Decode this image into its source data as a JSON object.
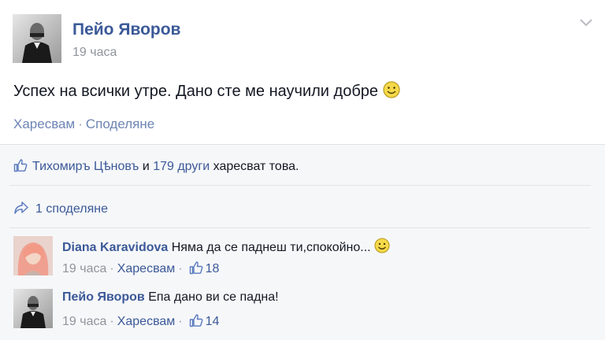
{
  "post": {
    "author": "Пейо Яворов",
    "timestamp": "19 часа",
    "text": "Успех на всички утре. Дано сте ме научили добре",
    "actions": {
      "like": "Харесвам",
      "share": "Споделяне",
      "separator": "·"
    }
  },
  "likes": {
    "first_name": "Тихомиръ Цѣновъ",
    "and": "и",
    "others": "179 други",
    "suffix": "харесват това."
  },
  "shares": {
    "label": "1 споделяне"
  },
  "comments": [
    {
      "author": "Diana Karavidova",
      "text": "Няма да се паднеш ти,спокойно...",
      "time": "19 часа",
      "like_label": "Харесвам",
      "like_count": "18"
    },
    {
      "author": "Пейо Яворов",
      "text": "Епа дано ви се падна!",
      "time": "19 часа",
      "like_label": "Харесвам",
      "like_count": "14"
    }
  ],
  "colors": {
    "link": "#3b5998",
    "muted": "#90949c",
    "panel": "#f6f7f9"
  }
}
